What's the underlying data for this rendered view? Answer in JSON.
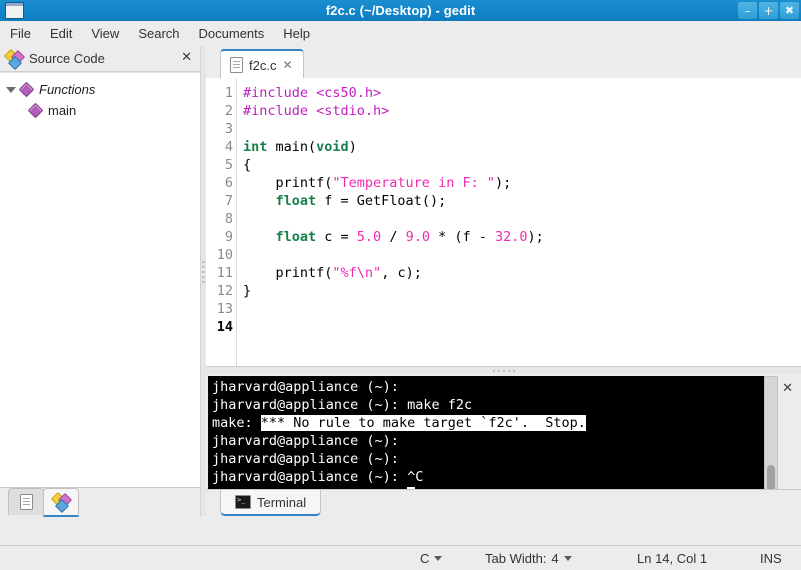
{
  "window": {
    "title": "f2c.c (~/Desktop) - gedit",
    "icon": "window-icon",
    "controls": {
      "minimize": "–",
      "maximize": "+",
      "close": "✖"
    }
  },
  "menubar": {
    "items": [
      "File",
      "Edit",
      "View",
      "Search",
      "Documents",
      "Help"
    ]
  },
  "sidebar": {
    "title": "Source Code",
    "close": "✕",
    "tree": [
      {
        "label": "Functions",
        "italic": true,
        "expanded": true
      },
      {
        "label": "main",
        "italic": false,
        "expanded": false
      }
    ],
    "tabs": [
      {
        "name": "documents-tab",
        "icon": "document-icon",
        "active": false
      },
      {
        "name": "source-code-tab",
        "icon": "source-code-icon",
        "active": true
      }
    ]
  },
  "editor": {
    "tab": {
      "label": "f2c.c",
      "icon": "document-icon",
      "close": "✕"
    },
    "line_numbers": [
      "1",
      "2",
      "3",
      "4",
      "5",
      "6",
      "7",
      "8",
      "9",
      "10",
      "11",
      "12",
      "13",
      "14"
    ],
    "current_line": 14,
    "lines": [
      {
        "n": 1,
        "text": "#include <cs50.h>"
      },
      {
        "n": 2,
        "text": "#include <stdio.h>"
      },
      {
        "n": 3,
        "text": ""
      },
      {
        "n": 4,
        "text": "int main(void)"
      },
      {
        "n": 5,
        "text": "{"
      },
      {
        "n": 6,
        "text": "    printf(\"Temperature in F: \");"
      },
      {
        "n": 7,
        "text": "    float f = GetFloat();"
      },
      {
        "n": 8,
        "text": ""
      },
      {
        "n": 9,
        "text": "    float c = 5.0 / 9.0 * (f - 32.0);"
      },
      {
        "n": 10,
        "text": ""
      },
      {
        "n": 11,
        "text": "    printf(\"%f\\n\", c);"
      },
      {
        "n": 12,
        "text": "}"
      },
      {
        "n": 13,
        "text": ""
      },
      {
        "n": 14,
        "text": ""
      }
    ]
  },
  "terminal": {
    "close": "✕",
    "tab": {
      "label": "Terminal",
      "icon": "terminal-icon"
    },
    "prompt": "jharvard@appliance (~): ",
    "lines": [
      {
        "prompt": "jharvard@appliance (~): ",
        "cmd": "",
        "selected": ""
      },
      {
        "prompt": "jharvard@appliance (~): ",
        "cmd": "make f2c",
        "selected": ""
      },
      {
        "prompt": "make: ",
        "cmd": "",
        "selected": "*** No rule to make target `f2c'.  Stop."
      },
      {
        "prompt": "jharvard@appliance (~): ",
        "cmd": "",
        "selected": ""
      },
      {
        "prompt": "jharvard@appliance (~): ",
        "cmd": "",
        "selected": ""
      },
      {
        "prompt": "jharvard@appliance (~): ",
        "cmd": "^C",
        "selected": ""
      },
      {
        "prompt": "jharvard@appliance (~): ",
        "cmd": "",
        "selected": "",
        "cursor": true
      }
    ]
  },
  "statusbar": {
    "language": "C",
    "tab_width_label": "Tab Width:",
    "tab_width_value": "4",
    "position": "Ln 14, Col 1",
    "insert_mode": "INS"
  },
  "colors": {
    "titlebar": "#1287cb",
    "accent": "#3584c6",
    "keyword": "#17804a",
    "preprocessor": "#c020c0",
    "string": "#ef2ab2",
    "chrome": "#ececec",
    "terminal_bg": "#000000",
    "terminal_fg": "#ffffff"
  }
}
